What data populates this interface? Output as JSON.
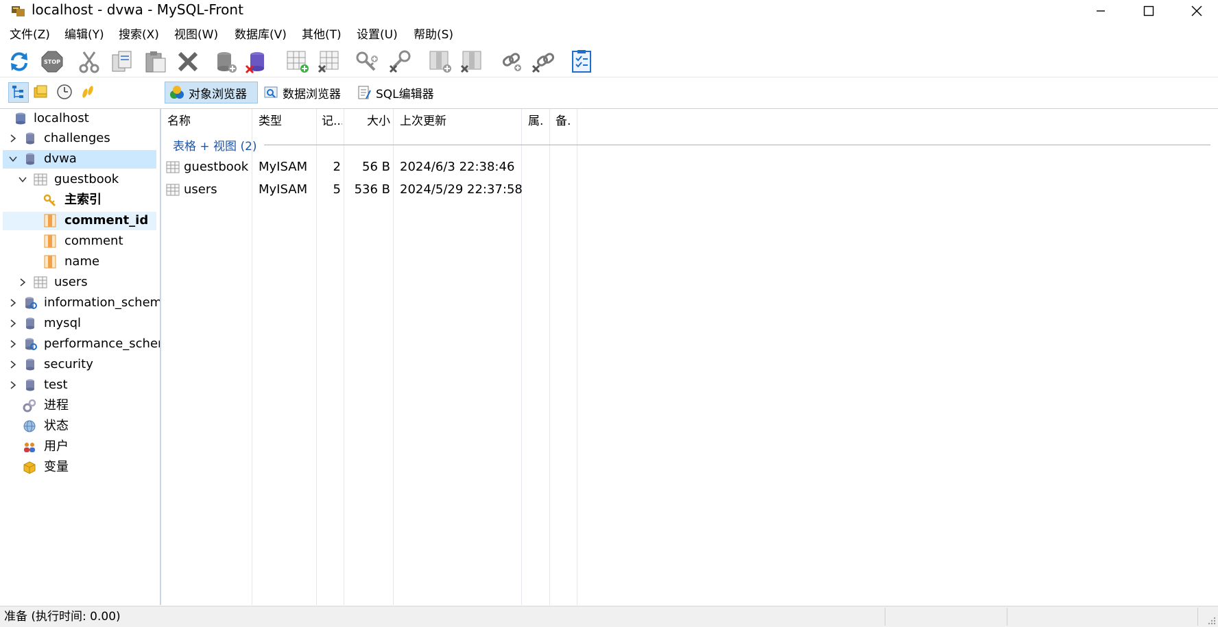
{
  "window": {
    "title": "localhost - dvwa - MySQL-Front"
  },
  "menu": [
    "文件(Z)",
    "编辑(Y)",
    "搜索(X)",
    "视图(W)",
    "数据库(V)",
    "其他(T)",
    "设置(U)",
    "帮助(S)"
  ],
  "toolbar_icons": [
    "refresh-icon",
    "stop-icon",
    "cut-icon",
    "copy-icon",
    "paste-icon",
    "delete-icon",
    "database-add-icon",
    "database-delete-icon",
    "table-add-icon",
    "table-delete-icon",
    "key-add-icon",
    "key-delete-icon",
    "field-add-icon",
    "field-delete-icon",
    "link-add-icon",
    "link-delete-icon",
    "checklist-icon"
  ],
  "view_tabs": [
    "对象浏览器",
    "数据浏览器",
    "SQL编辑器"
  ],
  "tree": {
    "root": "localhost",
    "items": [
      "challenges",
      "dvwa",
      "guestbook",
      "主索引",
      "comment_id",
      "comment",
      "name",
      "users",
      "information_schema",
      "mysql",
      "performance_schema",
      "security",
      "test",
      "进程",
      "状态",
      "用户",
      "变量"
    ]
  },
  "grid": {
    "columns": [
      "名称",
      "类型",
      "记...",
      "大小",
      "上次更新",
      "属.",
      "备."
    ],
    "group_label": "表格 + 视图 (2)",
    "rows": [
      [
        "guestbook",
        "MyISAM",
        "2",
        "56 B",
        "2024/6/3 22:38:46"
      ],
      [
        "users",
        "MyISAM",
        "5",
        "536 B",
        "2024/5/29 22:37:58"
      ]
    ]
  },
  "status": {
    "text": "准备  (执行时间: 0.00)"
  },
  "colors": {
    "selection": "#cce8ff",
    "active_tab": "#cde4f7",
    "group_label": "#1e54a8"
  }
}
